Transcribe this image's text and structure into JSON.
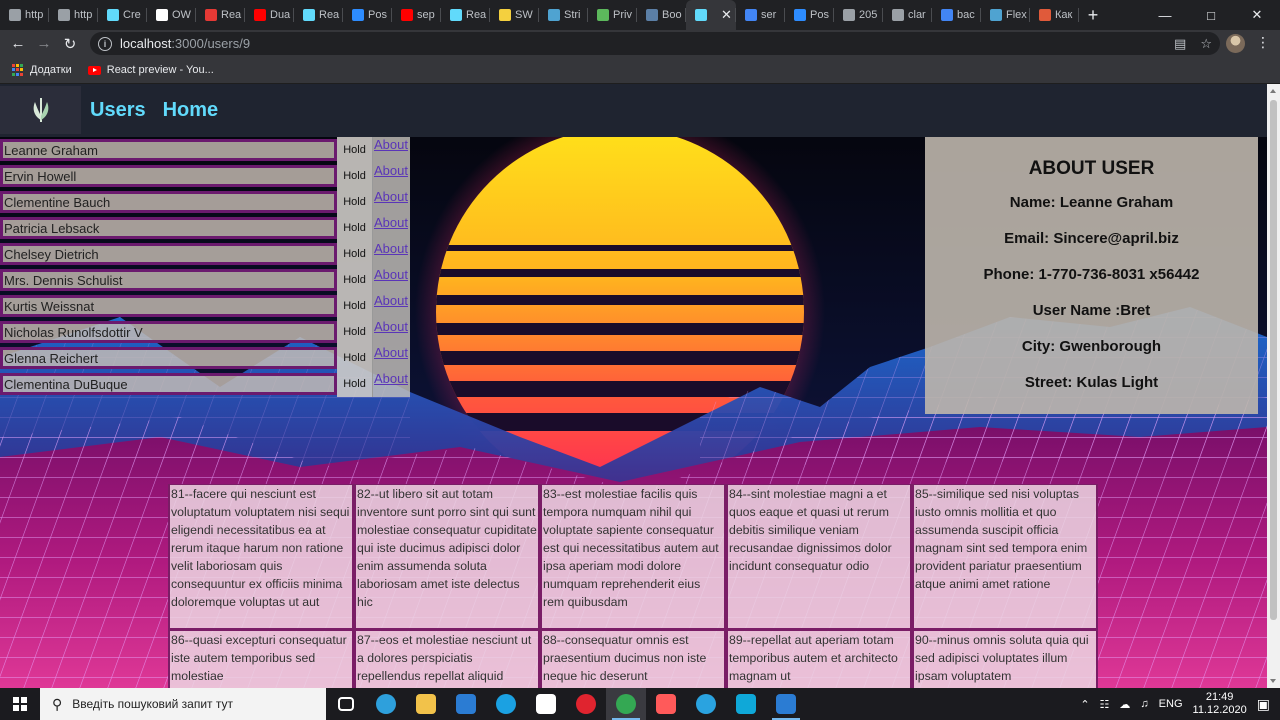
{
  "browser": {
    "tabs": [
      {
        "label": "http",
        "icon": "globe-icon",
        "color": "#9aa0a6"
      },
      {
        "label": "http",
        "icon": "globe-icon",
        "color": "#9aa0a6"
      },
      {
        "label": "Cre",
        "icon": "react-icon",
        "color": "#61dafb"
      },
      {
        "label": "OW",
        "icon": "github-icon",
        "color": "#ffffff"
      },
      {
        "label": "Rea",
        "icon": "chevron-icon",
        "color": "#e53935"
      },
      {
        "label": "Dua",
        "icon": "youtube-icon",
        "color": "#ff0000"
      },
      {
        "label": "Rea",
        "icon": "react-icon",
        "color": "#61dafb"
      },
      {
        "label": "Pos",
        "icon": "zoom-icon",
        "color": "#2d8cff"
      },
      {
        "label": "sep",
        "icon": "youtube-icon",
        "color": "#ff0000"
      },
      {
        "label": "Rea",
        "icon": "react-icon",
        "color": "#61dafb"
      },
      {
        "label": "SW",
        "icon": "sw-icon",
        "color": "#f4d03f"
      },
      {
        "label": "Stri",
        "icon": "stripe-icon",
        "color": "#4fa3d1"
      },
      {
        "label": "Priv",
        "icon": "privat-icon",
        "color": "#5cb85c"
      },
      {
        "label": "Boo",
        "icon": "habr-icon",
        "color": "#5b7fa6"
      },
      {
        "label": "",
        "icon": "react-icon",
        "color": "#61dafb",
        "active": true
      },
      {
        "label": "ser",
        "icon": "google-icon",
        "color": "#4285f4"
      },
      {
        "label": "Pos",
        "icon": "zoom-icon",
        "color": "#2d8cff"
      },
      {
        "label": "205",
        "icon": "globe-icon",
        "color": "#9aa0a6"
      },
      {
        "label": "clar",
        "icon": "globe-icon",
        "color": "#9aa0a6"
      },
      {
        "label": "bac",
        "icon": "google-icon",
        "color": "#4285f4"
      },
      {
        "label": "Flex",
        "icon": "flex-icon",
        "color": "#4fa3d1"
      },
      {
        "label": "Как",
        "icon": "text-icon",
        "color": "#e05a3a"
      }
    ],
    "url_host": "localhost",
    "url_path": ":3000/users/9",
    "bookmarks": [
      {
        "label": "Додатки",
        "icon": "apps-grid-icon"
      },
      {
        "label": "React preview - You...",
        "icon": "youtube-icon"
      }
    ]
  },
  "app": {
    "nav": [
      "Users",
      "Home"
    ],
    "hold_label": "Hold",
    "about_label": "About",
    "users": [
      "Leanne Graham",
      "Ervin Howell",
      "Clementine Bauch",
      "Patricia Lebsack",
      "Chelsey Dietrich",
      "Mrs. Dennis Schulist",
      "Kurtis Weissnat",
      "Nicholas Runolfsdottir V",
      "Glenna Reichert",
      "Clementina DuBuque"
    ],
    "about_user": {
      "title": "ABOUT USER",
      "lines": [
        "Name: Leanne Graham",
        "Email: Sincere@april.biz",
        "Phone: 1-770-736-8031 x56442",
        "User Name :Bret",
        "City: Gwenborough",
        "Street: Kulas Light"
      ]
    },
    "posts": [
      "81--facere qui nesciunt est voluptatum voluptatem nisi sequi eligendi necessitatibus ea at rerum itaque harum non ratione velit laboriosam quis consequuntur ex officiis minima doloremque voluptas ut aut",
      "82--ut libero sit aut totam inventore sunt porro sint qui sunt molestiae consequatur cupiditate qui iste ducimus adipisci dolor enim assumenda soluta laboriosam amet iste delectus hic",
      "83--est molestiae facilis quis tempora numquam nihil qui voluptate sapiente consequatur est qui necessitatibus autem aut ipsa aperiam modi dolore numquam reprehenderit eius rem quibusdam",
      "84--sint molestiae magni a et quos eaque et quasi ut rerum debitis similique veniam recusandae dignissimos dolor incidunt consequatur odio",
      "85--similique sed nisi voluptas iusto omnis mollitia et quo assumenda suscipit officia magnam sint sed tempora enim provident pariatur praesentium atque animi amet ratione",
      "86--quasi excepturi consequatur iste autem temporibus sed molestiae",
      "87--eos et molestiae nesciunt ut a dolores perspiciatis repellendus repellat aliquid",
      "88--consequatur omnis est praesentium ducimus non iste neque hic deserunt",
      "89--repellat aut aperiam totam temporibus autem et architecto magnam ut",
      "90--minus omnis soluta quia qui sed adipisci voluptates illum ipsam voluptatem"
    ]
  },
  "taskbar": {
    "search_placeholder": "Введіть пошуковий запит тут",
    "apps": [
      {
        "name": "task-view-icon",
        "color": "#ffffff"
      },
      {
        "name": "edge-icon",
        "color": "#2ea0dc"
      },
      {
        "name": "file-explorer-icon",
        "color": "#f2c24a"
      },
      {
        "name": "mail-icon",
        "color": "#2b7cd3"
      },
      {
        "name": "skype-icon",
        "color": "#1ba1e2"
      },
      {
        "name": "unity-icon",
        "color": "#ffffff"
      },
      {
        "name": "opera-icon",
        "color": "#e0242f"
      },
      {
        "name": "chrome-icon",
        "color": "#34a853"
      },
      {
        "name": "zoom-icon",
        "color": "#ff5a5a"
      },
      {
        "name": "telegram-icon",
        "color": "#2aa3e0"
      },
      {
        "name": "webstorm-icon",
        "color": "#0fa8d8"
      },
      {
        "name": "app-icon",
        "color": "#2b7cd3"
      }
    ],
    "language": "ENG",
    "time": "21:49",
    "date": "11.12.2020"
  }
}
